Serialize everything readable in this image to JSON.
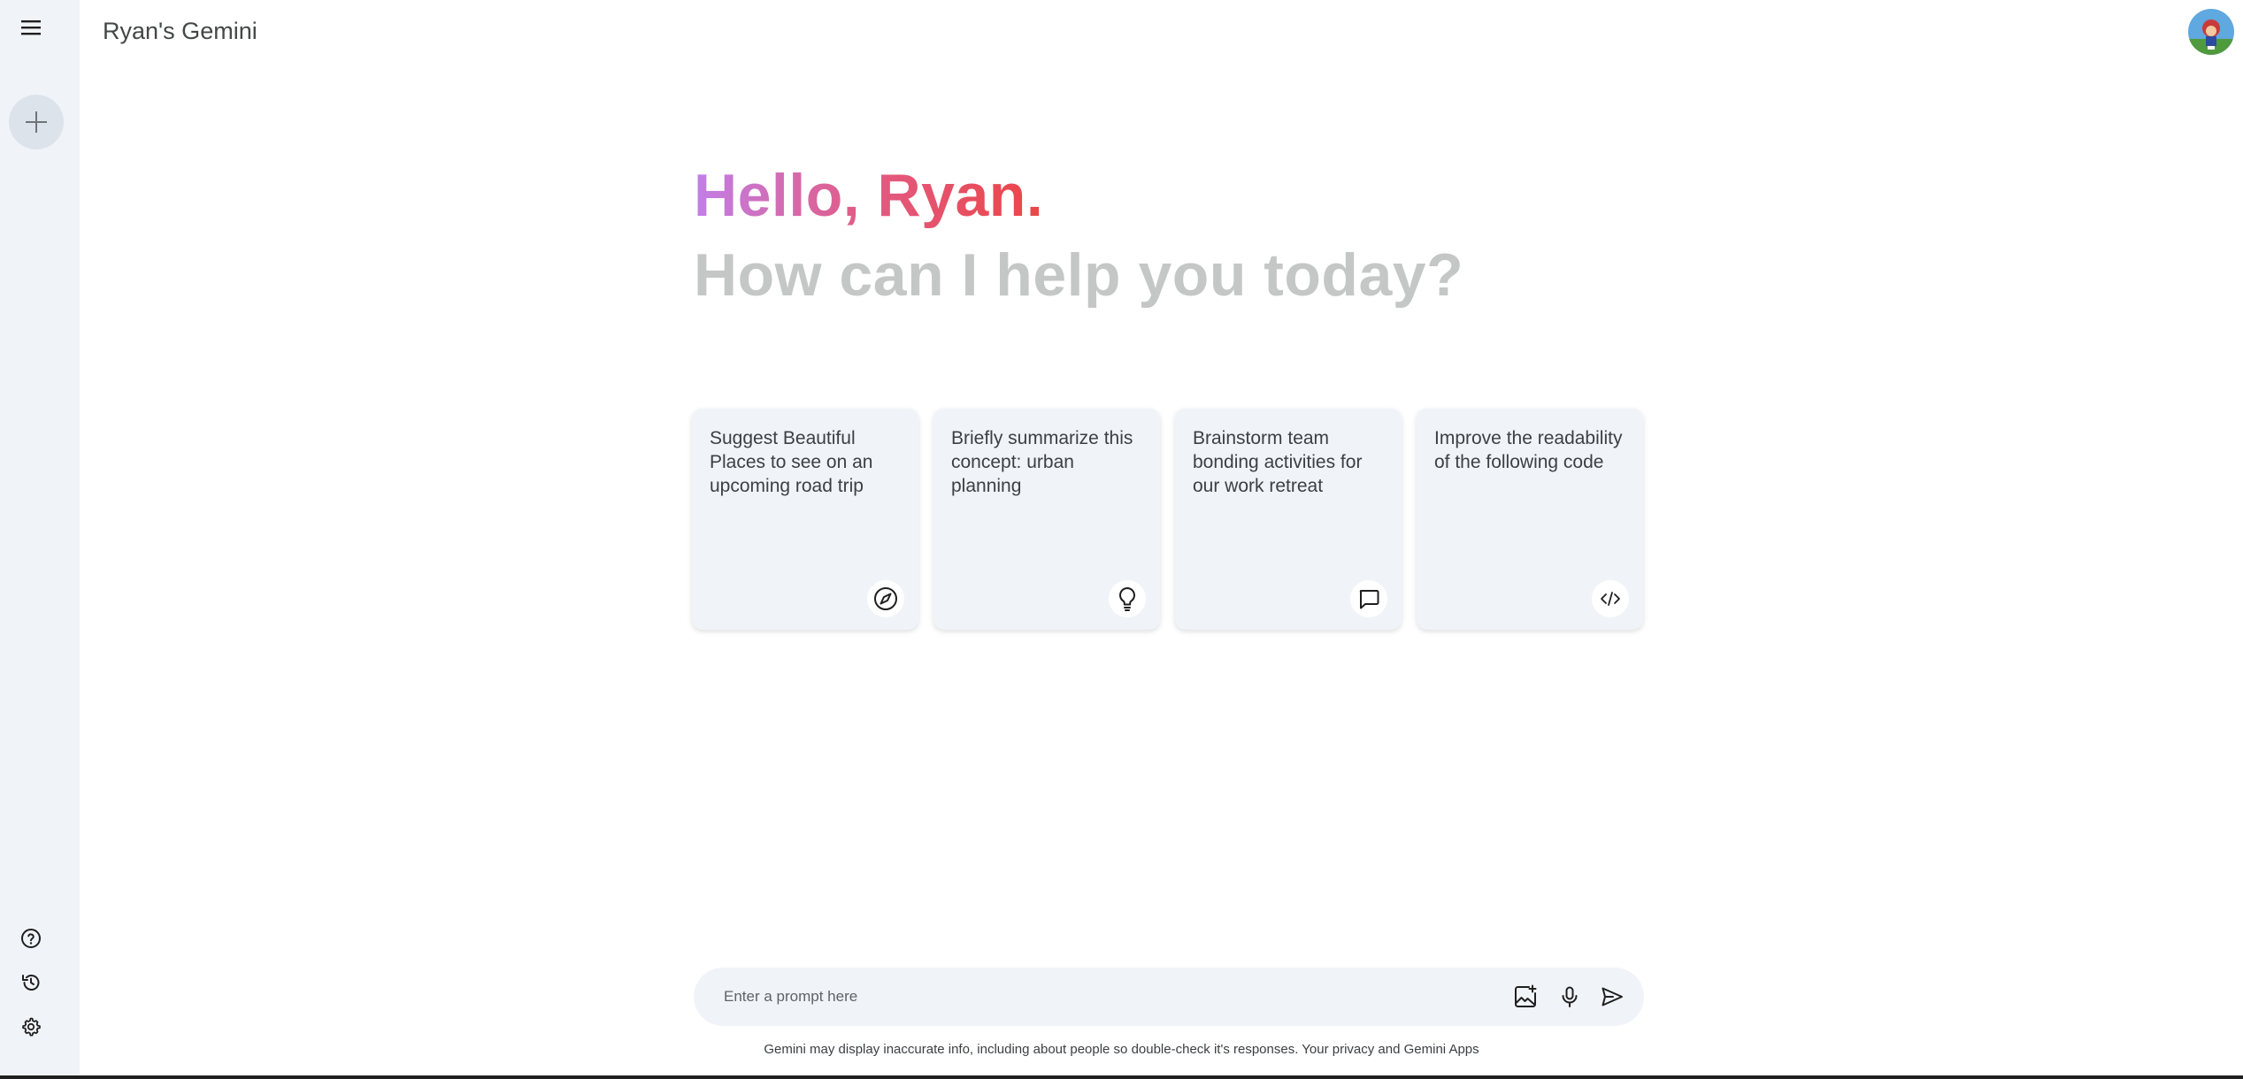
{
  "app": {
    "title": "Ryan's Gemini"
  },
  "sidebar": {
    "menu_icon": "hamburger-menu-icon",
    "new_chat_icon": "plus-icon",
    "bottom": [
      {
        "icon": "help-icon"
      },
      {
        "icon": "history-icon"
      },
      {
        "icon": "settings-gear-icon"
      }
    ]
  },
  "hero": {
    "greeting": "Hello, Ryan.",
    "subtitle": "How can I help you today?"
  },
  "cards": [
    {
      "text": "Suggest Beautiful Places to see on an upcoming road trip",
      "icon": "compass-icon"
    },
    {
      "text": "Briefly summarize this concept: urban planning",
      "icon": "lightbulb-icon"
    },
    {
      "text": "Brainstorm team bonding activities for our work retreat",
      "icon": "chat-bubble-icon"
    },
    {
      "text": "Improve the readability of the following code",
      "icon": "code-icon"
    }
  ],
  "prompt": {
    "placeholder": "Enter a prompt here",
    "image_icon": "add-image-icon",
    "mic_icon": "microphone-icon",
    "send_icon": "send-icon"
  },
  "disclaimer": "Gemini may display inaccurate info, including about people so double-check it's responses. Your privacy and Gemini Apps",
  "colors": {
    "sidebar_bg": "#f0f4f9",
    "greeting_gradient_start": "#c17fe8",
    "greeting_gradient_end": "#ec4545",
    "subtitle": "#c4c7c5",
    "card_bg": "#f0f4f9"
  }
}
